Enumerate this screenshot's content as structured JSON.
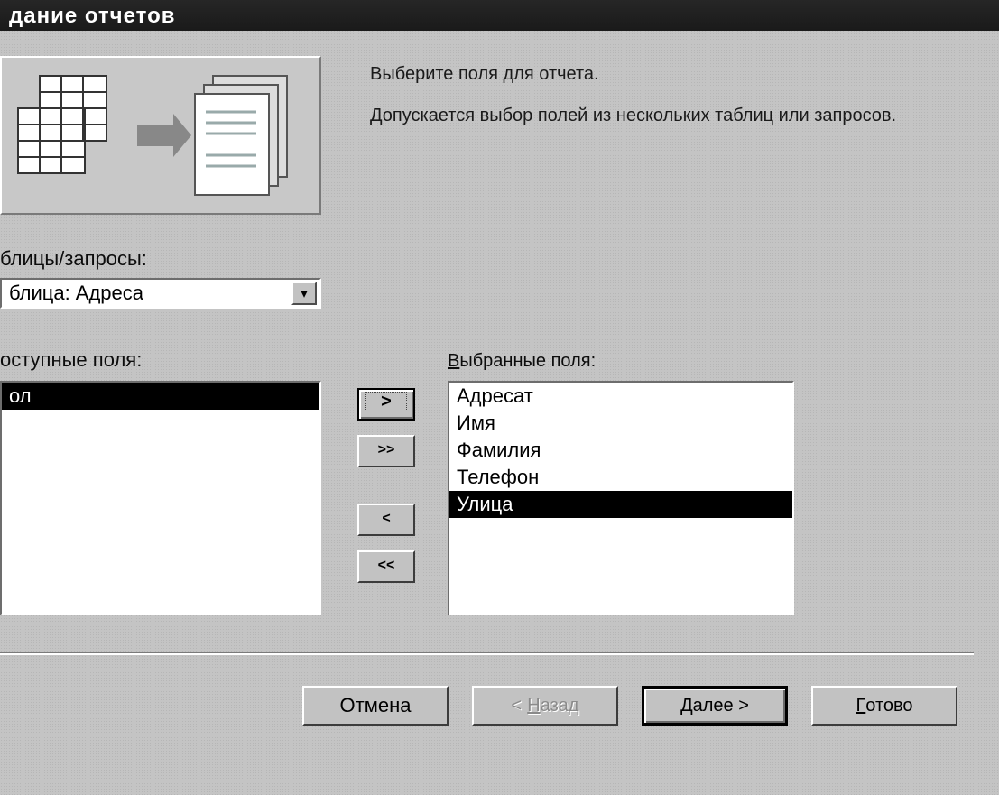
{
  "title": "дание отчетов",
  "instructions": {
    "line1": "Выберите поля для отчета.",
    "line2": "Допускается выбор полей из нескольких таблиц или запросов."
  },
  "labels": {
    "tables_queries_prefix": "блицы/запросы:",
    "available_prefix": "оступные поля:",
    "selected_prefix_u": "В",
    "selected_rest": "ыбранные поля:"
  },
  "combo": {
    "value": "блица: Адреса"
  },
  "available_fields": [
    "ол"
  ],
  "selected_fields": [
    {
      "text": "Адресат",
      "sel": false
    },
    {
      "text": "Имя",
      "sel": false
    },
    {
      "text": "Фамилия",
      "sel": false
    },
    {
      "text": "Телефон",
      "sel": false
    },
    {
      "text": "Улица",
      "sel": true
    }
  ],
  "movers": {
    "add": ">",
    "addall": ">>",
    "remove": "<",
    "removeall": "<<"
  },
  "nav": {
    "cancel": "Отмена",
    "back_lt": "<",
    "back_u": "Н",
    "back_rest": "азад",
    "next_u": "Д",
    "next_rest": "алее >",
    "finish_u": "Г",
    "finish_rest": "отово"
  }
}
